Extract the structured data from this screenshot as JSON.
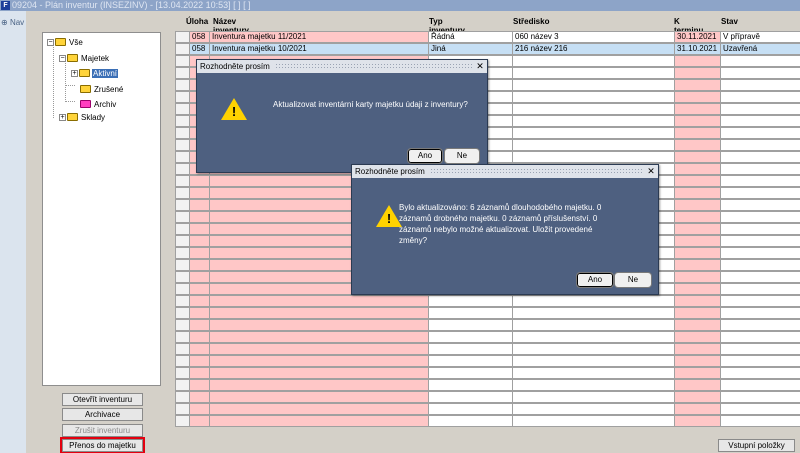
{
  "window": {
    "title": "09204 - Plán inventur (INSEZINV) - [13.04.2022  10:53] [ ] [ ]",
    "icon_text": "F"
  },
  "nav": {
    "label": "Nav"
  },
  "tree": {
    "items": [
      {
        "label": "Vše"
      },
      {
        "label": "Majetek"
      },
      {
        "label": "Aktivní"
      },
      {
        "label": "Zrušené"
      },
      {
        "label": "Archiv"
      },
      {
        "label": "Sklady"
      }
    ]
  },
  "buttons": {
    "open": "Otevřít inventuru",
    "archive": "Archivace",
    "cancel": "Zrušit inventuru",
    "transfer": "Přenos do majetku",
    "items": "Vstupní položky"
  },
  "grid": {
    "columns": [
      "Úloha",
      "Název inventury",
      "Typ inventury",
      "Středisko",
      "K terminu",
      "Stav"
    ],
    "rows": [
      {
        "task": "058",
        "name": "Inventura majetku 11/2021",
        "type": "Řádná",
        "center": "060 název 3",
        "due": "30.11.2021",
        "status": "V přípravě"
      },
      {
        "task": "058",
        "name": "Inventura majetku 10/2021",
        "type": "Jiná",
        "center": "216 název 216",
        "due": "31.10.2021",
        "status": "Uzavřená"
      }
    ]
  },
  "dialog1": {
    "title": "Rozhodněte prosím",
    "message": "Aktualizovat inventární karty majetku údaji z inventury?",
    "yes": "Ano",
    "no": "Ne"
  },
  "dialog2": {
    "title": "Rozhodněte prosím",
    "message_lines": [
      "Bylo aktualizováno: 6 záznamů dlouhodobého majetku. 0",
      "záznamů drobného majetku. 0 záznamů příslušenství. 0",
      "záznamů nebylo možné aktualizovat. Uložit provedené",
      "změny?"
    ],
    "yes": "Ano",
    "no": "Ne"
  },
  "colors": {
    "pink_column": "#ffc7c7",
    "selected_row": "#c6dff4",
    "dialog_bg": "#4e6080",
    "warning": "#ffd200",
    "highlight_outline": "#e3000f"
  }
}
